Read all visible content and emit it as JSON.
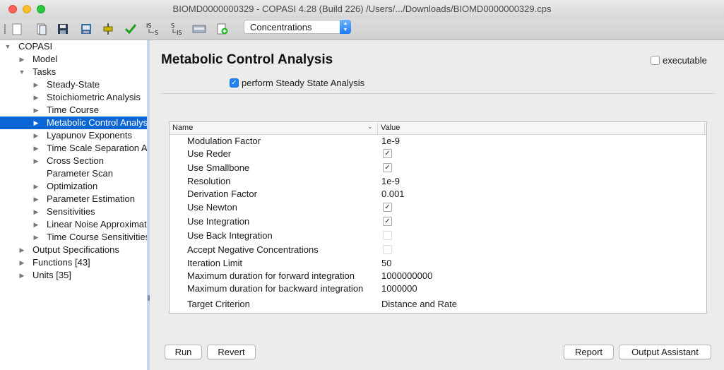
{
  "window": {
    "title": "BIOMD0000000329 - COPASI 4.28 (Build 226) /Users/.../Downloads/BIOMD0000000329.cps"
  },
  "toolbar": {
    "icons": [
      "new-file-icon",
      "open-file-icon",
      "save-icon",
      "save-as-icon",
      "slider-icon",
      "check-icon",
      "is-to-s-icon",
      "s-to-is-icon",
      "sbml-icon",
      "add-icon"
    ],
    "is_s_label": "IS→S",
    "s_is_label": "S→IS",
    "mode_select": "Concentrations"
  },
  "tree": {
    "items": [
      {
        "label": "COPASI",
        "twisty": "▼"
      },
      {
        "label": "Model",
        "twisty": "▶"
      },
      {
        "label": "Tasks",
        "twisty": "▼"
      },
      {
        "label": "Steady-State",
        "twisty": "▶"
      },
      {
        "label": "Stoichiometric Analysis",
        "twisty": "▶"
      },
      {
        "label": "Time Course",
        "twisty": "▶"
      },
      {
        "label": "Metabolic Control Analysis",
        "twisty": "▶"
      },
      {
        "label": "Lyapunov Exponents",
        "twisty": "▶"
      },
      {
        "label": "Time Scale Separation Analysis",
        "twisty": "▶"
      },
      {
        "label": "Cross Section",
        "twisty": "▶"
      },
      {
        "label": "Parameter Scan",
        "twisty": ""
      },
      {
        "label": "Optimization",
        "twisty": "▶"
      },
      {
        "label": "Parameter Estimation",
        "twisty": "▶"
      },
      {
        "label": "Sensitivities",
        "twisty": "▶"
      },
      {
        "label": "Linear Noise Approximation",
        "twisty": "▶"
      },
      {
        "label": "Time Course Sensitivities",
        "twisty": "▶"
      },
      {
        "label": "Output Specifications",
        "twisty": "▶"
      },
      {
        "label": "Functions [43]",
        "twisty": "▶"
      },
      {
        "label": "Units [35]",
        "twisty": "▶"
      }
    ]
  },
  "main": {
    "heading": "Metabolic Control Analysis",
    "executable_label": "executable",
    "executable_checked": false,
    "perform_ss_label": "perform Steady State Analysis",
    "perform_ss_checked": true,
    "table": {
      "col_name": "Name",
      "col_value": "Value",
      "rows": [
        {
          "name": "Modulation Factor",
          "value": "1e-9"
        },
        {
          "name": "Use Reder",
          "check": "on"
        },
        {
          "name": "Use Smallbone",
          "check": "on"
        },
        {
          "name": "Resolution",
          "value": "1e-9"
        },
        {
          "name": "Derivation Factor",
          "value": "0.001"
        },
        {
          "name": "Use Newton",
          "check": "on"
        },
        {
          "name": "Use Integration",
          "check": "on"
        },
        {
          "name": "Use Back Integration",
          "check": "disabled"
        },
        {
          "name": "Accept Negative Concentrations",
          "check": "disabled"
        },
        {
          "name": "Iteration Limit",
          "value": "50"
        },
        {
          "name": "Maximum duration for forward integration",
          "value": "1000000000"
        },
        {
          "name": "Maximum duration for backward integration",
          "value": "1000000"
        },
        {
          "name": "Target Criterion",
          "value": "Distance and Rate"
        }
      ]
    },
    "buttons": {
      "run": "Run",
      "revert": "Revert",
      "report": "Report",
      "output_assistant": "Output Assistant"
    }
  },
  "colors": {
    "selection": "#0a66d6",
    "checkbox_on": "#1e82f0"
  }
}
